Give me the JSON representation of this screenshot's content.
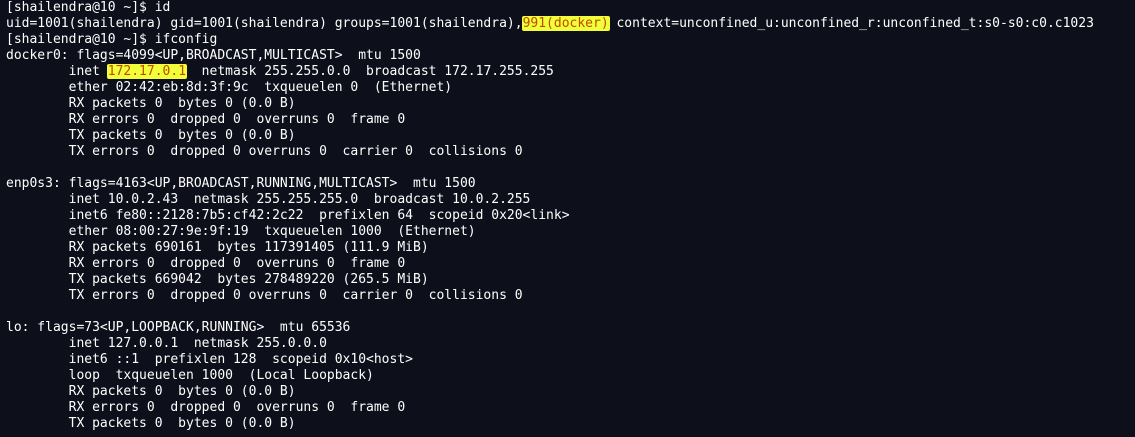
{
  "terminal": {
    "lines": [
      {
        "segments": [
          {
            "text": "[shailendra@10 ~]$ id"
          }
        ]
      },
      {
        "segments": [
          {
            "text": "uid=1001(shailendra) gid=1001(shailendra) groups=1001(shailendra),"
          },
          {
            "text": "991(docker)",
            "highlight": true
          },
          {
            "text": " context=unconfined_u:unconfined_r:unconfined_t:s0-s0:c0.c1023"
          }
        ]
      },
      {
        "segments": [
          {
            "text": "[shailendra@10 ~]$ ifconfig"
          }
        ]
      },
      {
        "segments": [
          {
            "text": "docker0: flags=4099<UP,BROADCAST,MULTICAST>  mtu 1500"
          }
        ]
      },
      {
        "segments": [
          {
            "text": "        inet "
          },
          {
            "text": "172.17.0.1",
            "highlight": true
          },
          {
            "text": "  netmask 255.255.0.0  broadcast 172.17.255.255"
          }
        ]
      },
      {
        "segments": [
          {
            "text": "        ether 02:42:eb:8d:3f:9c  txqueuelen 0  (Ethernet)"
          }
        ]
      },
      {
        "segments": [
          {
            "text": "        RX packets 0  bytes 0 (0.0 B)"
          }
        ]
      },
      {
        "segments": [
          {
            "text": "        RX errors 0  dropped 0  overruns 0  frame 0"
          }
        ]
      },
      {
        "segments": [
          {
            "text": "        TX packets 0  bytes 0 (0.0 B)"
          }
        ]
      },
      {
        "segments": [
          {
            "text": "        TX errors 0  dropped 0 overruns 0  carrier 0  collisions 0"
          }
        ]
      },
      {
        "segments": [
          {
            "text": ""
          }
        ]
      },
      {
        "segments": [
          {
            "text": "enp0s3: flags=4163<UP,BROADCAST,RUNNING,MULTICAST>  mtu 1500"
          }
        ]
      },
      {
        "segments": [
          {
            "text": "        inet 10.0.2.43  netmask 255.255.255.0  broadcast 10.0.2.255"
          }
        ]
      },
      {
        "segments": [
          {
            "text": "        inet6 fe80::2128:7b5:cf42:2c22  prefixlen 64  scopeid 0x20<link>"
          }
        ]
      },
      {
        "segments": [
          {
            "text": "        ether 08:00:27:9e:9f:19  txqueuelen 1000  (Ethernet)"
          }
        ]
      },
      {
        "segments": [
          {
            "text": "        RX packets 690161  bytes 117391405 (111.9 MiB)"
          }
        ]
      },
      {
        "segments": [
          {
            "text": "        RX errors 0  dropped 0  overruns 0  frame 0"
          }
        ]
      },
      {
        "segments": [
          {
            "text": "        TX packets 669042  bytes 278489220 (265.5 MiB)"
          }
        ]
      },
      {
        "segments": [
          {
            "text": "        TX errors 0  dropped 0 overruns 0  carrier 0  collisions 0"
          }
        ]
      },
      {
        "segments": [
          {
            "text": ""
          }
        ]
      },
      {
        "segments": [
          {
            "text": "lo: flags=73<UP,LOOPBACK,RUNNING>  mtu 65536"
          }
        ]
      },
      {
        "segments": [
          {
            "text": "        inet 127.0.0.1  netmask 255.0.0.0"
          }
        ]
      },
      {
        "segments": [
          {
            "text": "        inet6 ::1  prefixlen 128  scopeid 0x10<host>"
          }
        ]
      },
      {
        "segments": [
          {
            "text": "        loop  txqueuelen 1000  (Local Loopback)"
          }
        ]
      },
      {
        "segments": [
          {
            "text": "        RX packets 0  bytes 0 (0.0 B)"
          }
        ]
      },
      {
        "segments": [
          {
            "text": "        RX errors 0  dropped 0  overruns 0  frame 0"
          }
        ]
      },
      {
        "segments": [
          {
            "text": "        TX packets 0  bytes 0 (0.0 B)"
          }
        ]
      }
    ]
  },
  "colors": {
    "background": "#0d0f1a",
    "text": "#ffffff",
    "highlight_bg": "#f0ff3a",
    "highlight_text": "#c24a00"
  }
}
